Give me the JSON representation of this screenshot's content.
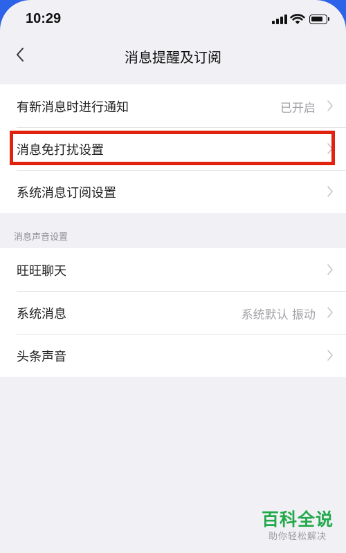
{
  "status_bar": {
    "time": "10:29"
  },
  "nav": {
    "title": "消息提醒及订阅"
  },
  "group1": {
    "items": [
      {
        "label": "有新消息时进行通知",
        "value": "已开启"
      },
      {
        "label": "消息免打扰设置",
        "value": ""
      },
      {
        "label": "系统消息订阅设置",
        "value": ""
      }
    ]
  },
  "section2": {
    "header": "消息声音设置",
    "items": [
      {
        "label": "旺旺聊天",
        "value": ""
      },
      {
        "label": "系统消息",
        "value": "系统默认 振动"
      },
      {
        "label": "头条声音",
        "value": ""
      }
    ]
  },
  "colors": {
    "highlight": "#e0220f",
    "background": "#f1f1f5",
    "watermark_green": "#22a94b"
  },
  "watermark": {
    "title": "百科全说",
    "subtitle": "助你轻松解决"
  }
}
